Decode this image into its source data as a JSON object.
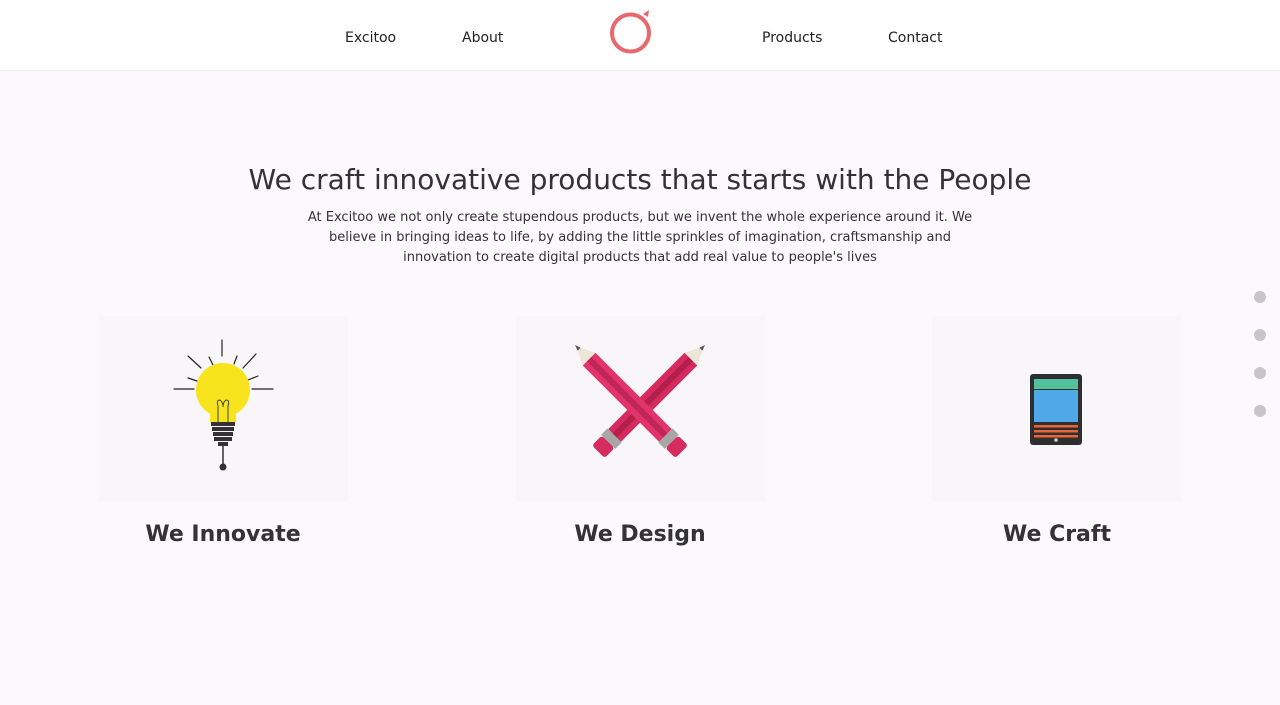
{
  "nav": {
    "items": [
      {
        "label": "Excitoo"
      },
      {
        "label": "About"
      },
      {
        "label": "Products"
      },
      {
        "label": "Contact"
      }
    ],
    "logo_icon": "brand-ring-icon"
  },
  "hero": {
    "title": "We craft innovative products that starts with the People",
    "text": "At Excitoo we not only create stupendous products, but we invent the whole experience around it. We believe in bringing ideas to life, by adding the little sprinkles of imagination, craftsmanship and innovation to create digital products that add real value to people's lives"
  },
  "features": [
    {
      "title": "We Innovate",
      "icon": "lightbulb-icon"
    },
    {
      "title": "We Design",
      "icon": "crossed-pencils-icon"
    },
    {
      "title": "We Craft",
      "icon": "tablet-icon"
    }
  ],
  "pagination": {
    "count": 4
  },
  "colors": {
    "brand": "#e8686d",
    "background": "#fbf9fc",
    "bulb": "#f7e41d",
    "pencil": "#d52b5e",
    "tablet_screen": "#4fa9e8",
    "tablet_header": "#52c09b",
    "tablet_lines": "#e8673a",
    "dot": "#c7c5c8"
  }
}
